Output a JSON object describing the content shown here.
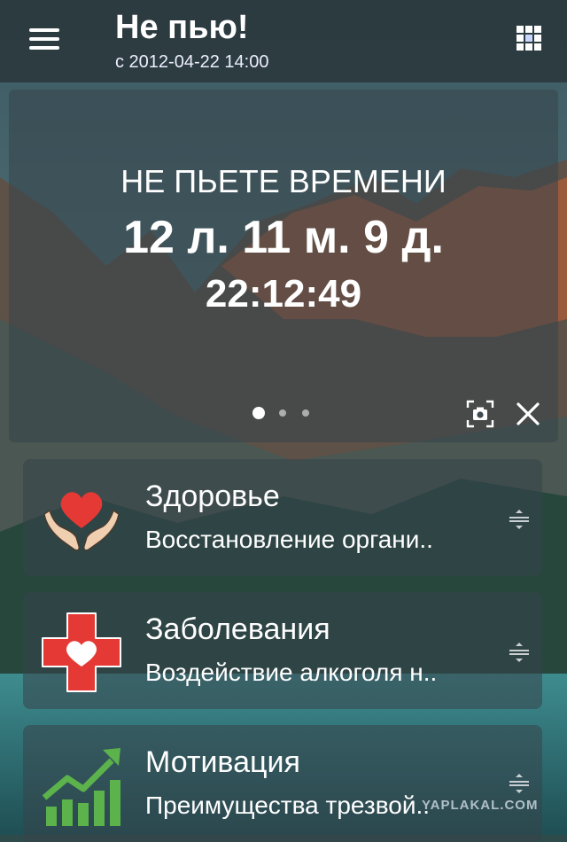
{
  "header": {
    "title": "Не пью!",
    "subtitle": "с 2012-04-22 14:00"
  },
  "hero": {
    "heading": "НЕ ПЬЕТЕ ВРЕМЕНИ",
    "duration": "12 л. 11 м. 9 д.",
    "time": "22:12:49",
    "page_count": 3,
    "active_page": 1
  },
  "cards": [
    {
      "title": "Здоровье",
      "description": "Восстановление органи..",
      "icon": "heart-in-hands-icon"
    },
    {
      "title": "Заболевания",
      "description": "Воздействие алкоголя н..",
      "icon": "medical-cross-heart-icon"
    },
    {
      "title": "Мотивация",
      "description": "Преимущества трезвой..",
      "icon": "growth-chart-icon"
    }
  ],
  "watermark": "YAPLAKAL.COM",
  "colors": {
    "red": "#e53935",
    "green": "#5cb24b",
    "skin": "#efcfb0"
  }
}
